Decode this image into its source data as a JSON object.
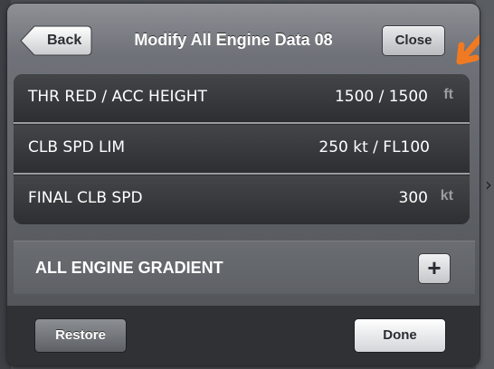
{
  "header": {
    "back_label": "Back",
    "title": "Modify All Engine Data 08",
    "close_label": "Close"
  },
  "engine_data": {
    "rows": [
      {
        "label": "THR RED / ACC HEIGHT",
        "value": "1500 / 1500",
        "unit": "ft"
      },
      {
        "label": "CLB SPD LIM",
        "value": "250 kt / FL100",
        "unit": ""
      },
      {
        "label": "FINAL CLB SPD",
        "value": "300",
        "unit": "kt"
      }
    ]
  },
  "gradient": {
    "label": "ALL ENGINE GRADIENT",
    "add_icon": "plus-icon",
    "add_glyph": "+"
  },
  "footer": {
    "restore_label": "Restore",
    "done_label": "Done"
  },
  "annotation": {
    "arrow_icon": "orange-arrow-icon",
    "arrow_color": "#f07a22"
  },
  "colors": {
    "panel_bg": "#6f7278",
    "data_bg": "#2b2c2f",
    "footer_bg": "#2f3134",
    "unit_text": "#9a9ca0"
  }
}
